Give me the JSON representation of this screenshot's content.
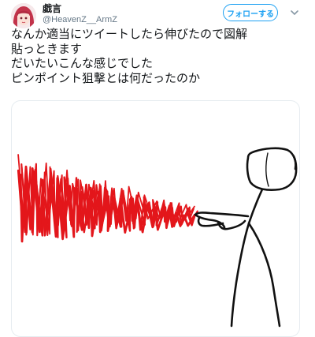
{
  "tweet": {
    "display_name": "戯言",
    "handle": "@HeavenZ__ArmZ",
    "follow_label": "フォローする",
    "text_lines": [
      "なんか適当にツイートしたら伸びたので図解",
      "貼っときます",
      "だいたいこんな感じでした",
      "ピンポイント狙撃とは何だったのか"
    ]
  },
  "icons": {
    "follow": "person-plus-icon",
    "menu": "chevron-down-icon"
  },
  "colors": {
    "accent": "#1da1f2",
    "spray": "#e3161b",
    "ink": "#111111",
    "handle": "#657786",
    "avatar_hair": "#c2334a"
  }
}
